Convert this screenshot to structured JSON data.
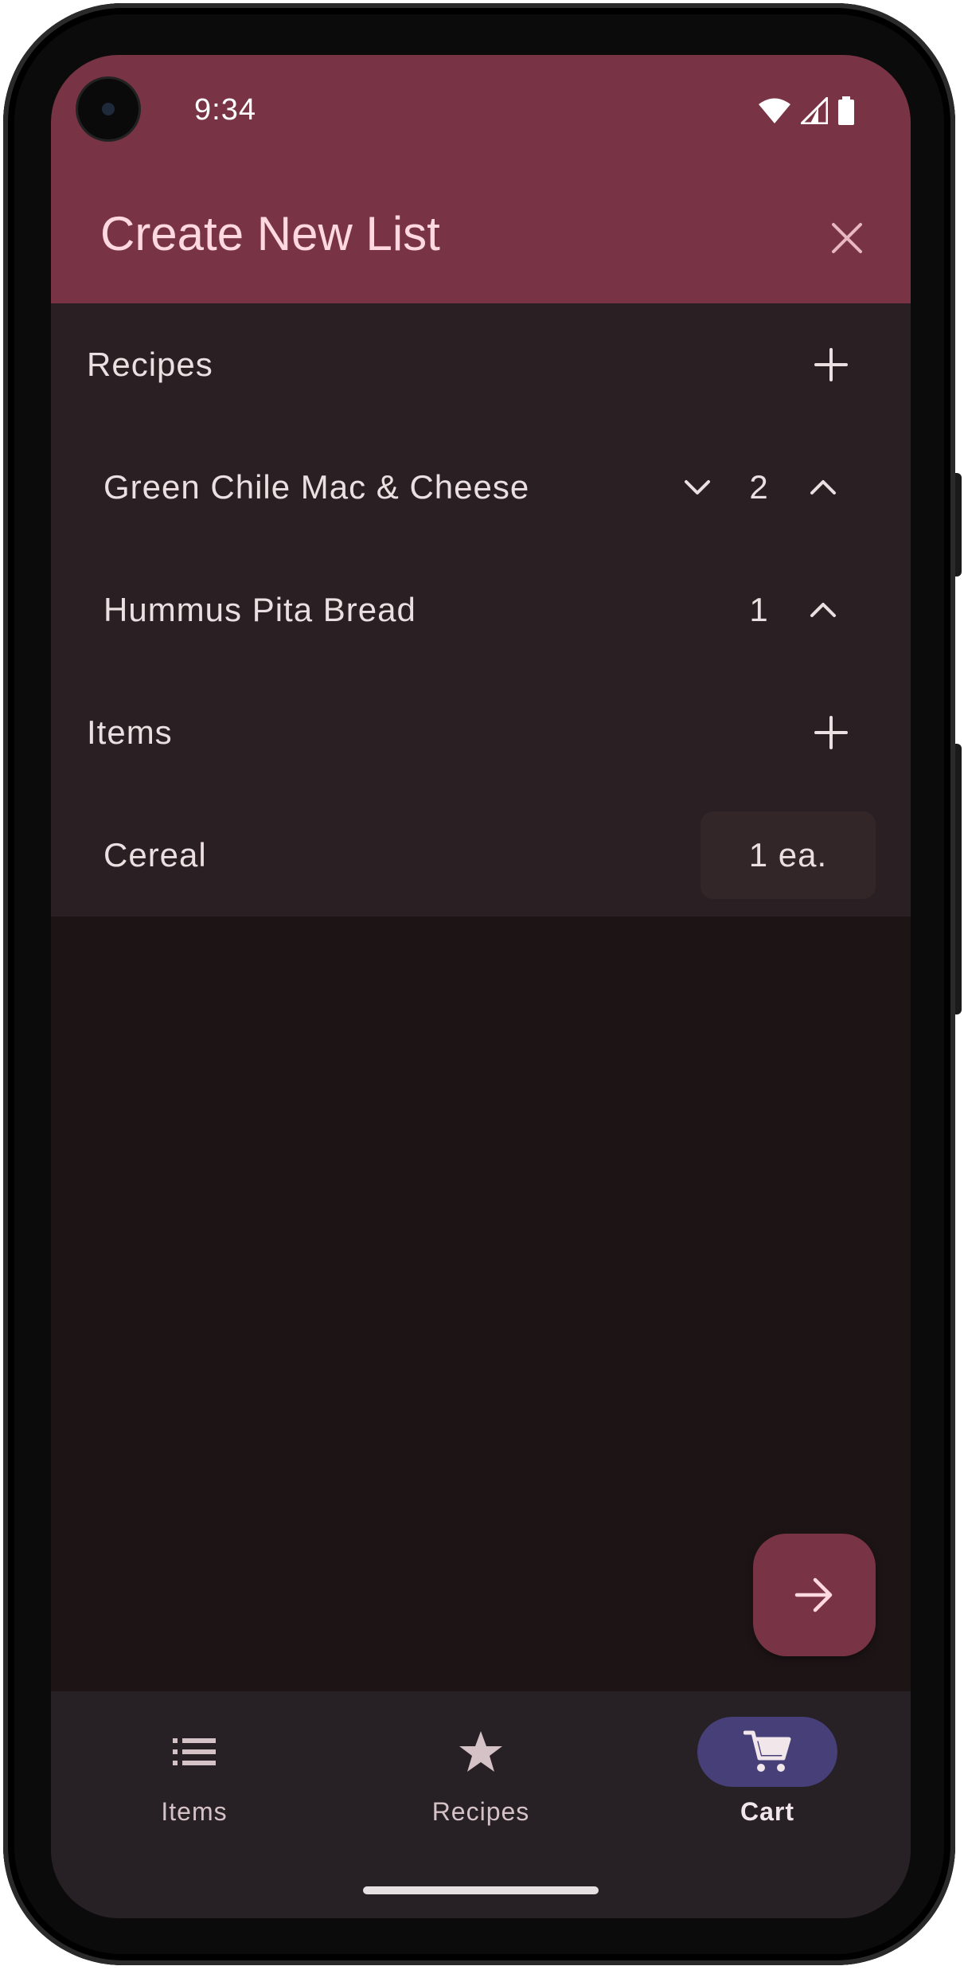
{
  "status_bar": {
    "time": "9:34"
  },
  "header": {
    "title": "Create New List"
  },
  "recipes_section": {
    "label": "Recipes",
    "items": [
      {
        "name": "Green Chile Mac & Cheese",
        "count": "2"
      },
      {
        "name": "Hummus Pita Bread",
        "count": "1"
      }
    ]
  },
  "items_section": {
    "label": "Items",
    "items": [
      {
        "name": "Cereal",
        "quantity": "1 ea."
      }
    ]
  },
  "bottom_nav": {
    "items": [
      {
        "label": "Items",
        "icon": "list-icon"
      },
      {
        "label": "Recipes",
        "icon": "star-icon"
      },
      {
        "label": "Cart",
        "icon": "cart-icon",
        "active": true
      }
    ]
  },
  "colors": {
    "appbar": "#783444",
    "background": "#1d1416",
    "surface": "#2a2024",
    "nav_active": "#473f77"
  }
}
